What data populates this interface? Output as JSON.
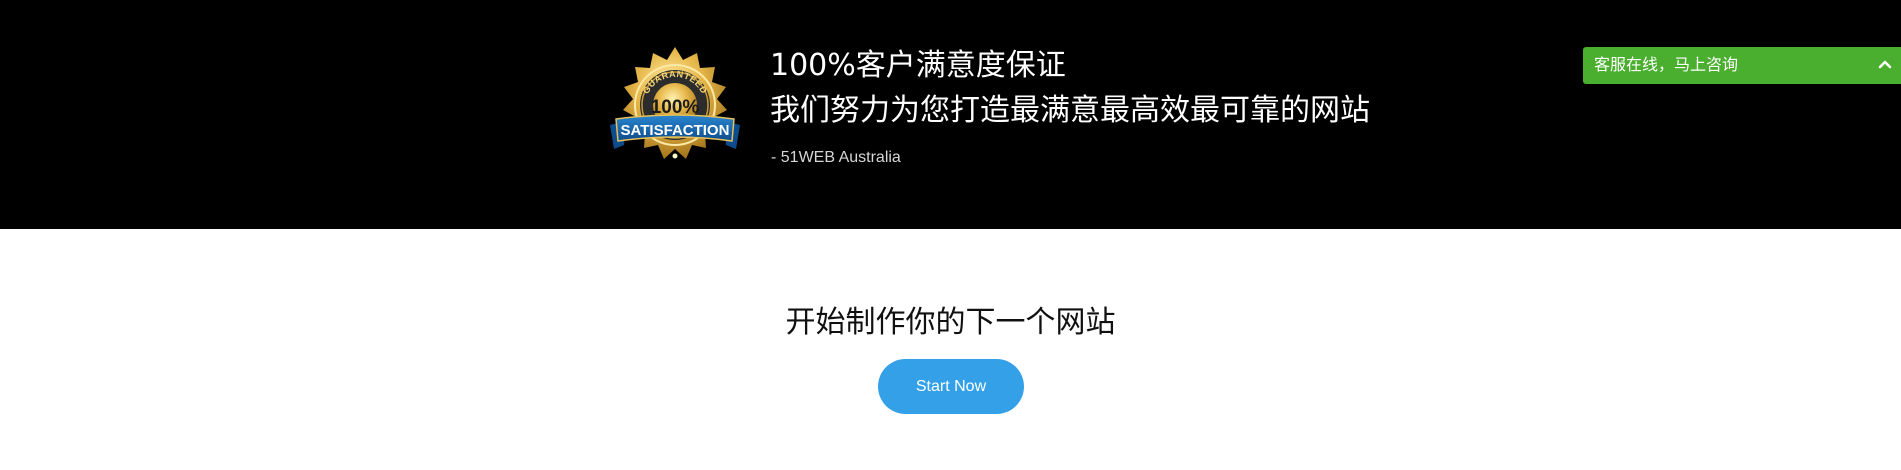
{
  "hero": {
    "badge": {
      "text_top": "GUARANTEED",
      "text_mid": "100%",
      "text_ribbon": "SATISFACTION",
      "gold": "#d9a42e",
      "ribbon": "#1560a8"
    },
    "title": "100%客户满意度保证",
    "subtitle": "我们努力为您打造最满意最高效最可靠的网站",
    "signature": "- 51WEB Australia"
  },
  "chat": {
    "label": "客服在线，马上咨询",
    "toggle_icon": "chevron-up-icon",
    "color": "#4aae2e"
  },
  "cta": {
    "title": "开始制作你的下一个网站",
    "button_label": "Start Now",
    "button_color": "#33a0e8"
  }
}
